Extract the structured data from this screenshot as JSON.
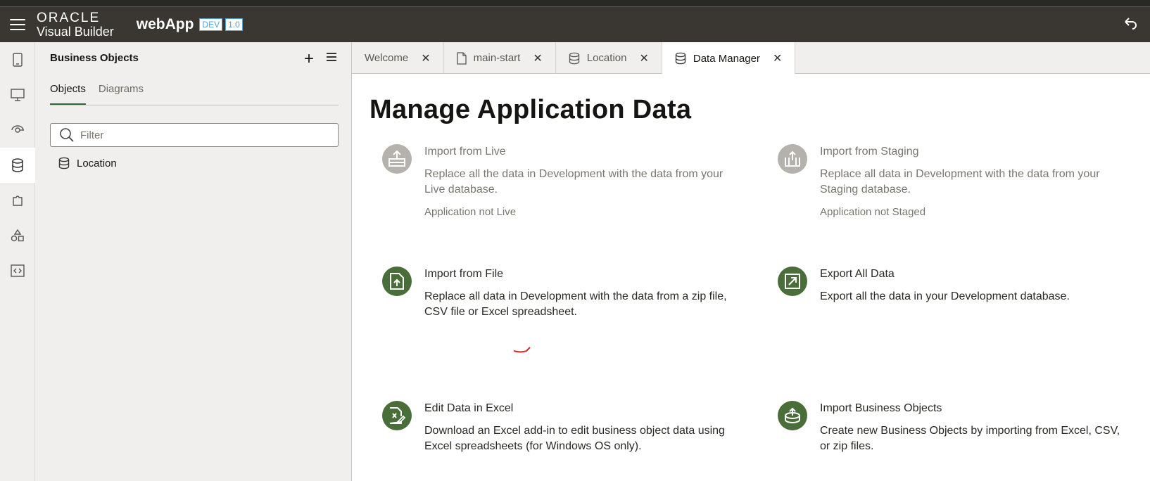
{
  "header": {
    "brand_line1": "ORACLE",
    "brand_line2": "Visual Builder",
    "app_name": "webApp",
    "env_badge": "DEV",
    "version_badge": "1.0",
    "undo_icon": "undo-icon"
  },
  "iconbar": {
    "items": [
      "mobile-apps-icon",
      "web-apps-icon",
      "services-icon",
      "business-objects-icon",
      "components-icon",
      "layout-icon",
      "source-icon"
    ],
    "active": "business-objects-icon"
  },
  "sidepanel": {
    "title": "Business Objects",
    "tabs": [
      {
        "label": "Objects",
        "active": true
      },
      {
        "label": "Diagrams",
        "active": false
      }
    ],
    "filter_placeholder": "Filter",
    "items": [
      {
        "label": "Location",
        "icon": "database-icon"
      }
    ]
  },
  "tabs": [
    {
      "label": "Welcome",
      "icon": null,
      "active": false
    },
    {
      "label": "main-start",
      "icon": "page-icon",
      "active": false
    },
    {
      "label": "Location",
      "icon": "database-icon",
      "active": false
    },
    {
      "label": "Data Manager",
      "icon": "database-icon",
      "active": true
    }
  ],
  "main": {
    "title": "Manage Application Data",
    "cards": [
      {
        "title": "Import from Live",
        "desc": "Replace all the data in Development with the data from your Live database.",
        "status": "Application not Live",
        "enabled": false
      },
      {
        "title": "Import from Staging",
        "desc": "Replace all data in Development with the data from your Staging database.",
        "status": "Application not Staged",
        "enabled": false
      },
      {
        "title": "Import from File",
        "desc": "Replace all data in Development with the data from a zip file, CSV file or Excel spreadsheet.",
        "status": "",
        "enabled": true
      },
      {
        "title": "Export All Data",
        "desc": "Export all the data in your Development database.",
        "status": "",
        "enabled": true
      },
      {
        "title": "Edit Data in Excel",
        "desc": "Download an Excel add-in to edit business object data using Excel spreadsheets (for Windows OS only).",
        "status": "",
        "enabled": true
      },
      {
        "title": "Import Business Objects",
        "desc": "Create new Business Objects by importing from Excel, CSV, or zip files.",
        "status": "",
        "enabled": true
      }
    ]
  },
  "colors": {
    "header_bg": "#3a3631",
    "accent_green": "#4a6e3a",
    "disabled_icon": "#b5b2ad",
    "badge_blue": "#4da3e0"
  }
}
